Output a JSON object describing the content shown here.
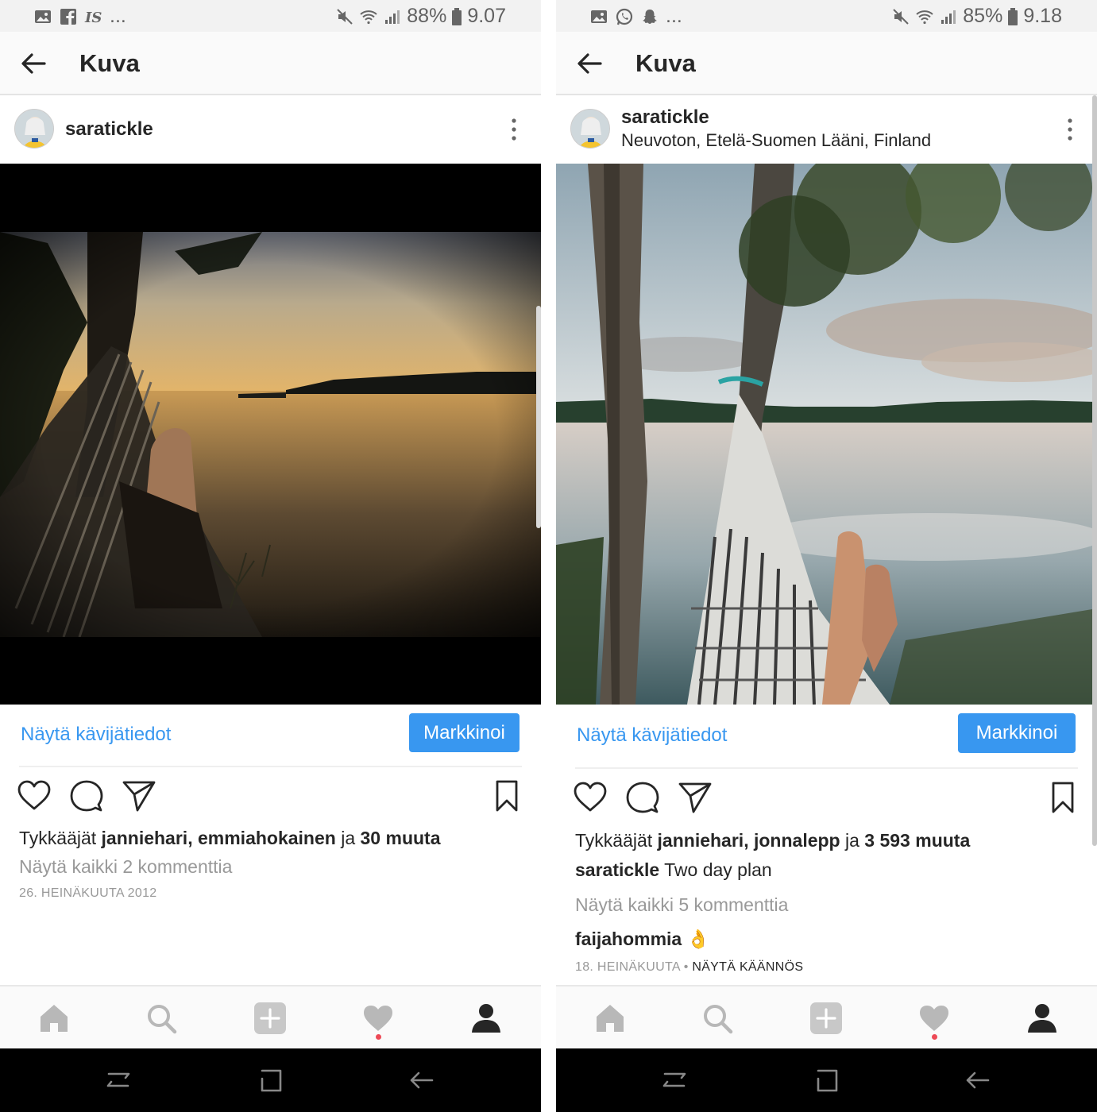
{
  "screens": [
    {
      "status": {
        "battery": "88%",
        "time": "9.07",
        "left_icons": [
          "image-icon",
          "facebook-icon",
          "is-icon"
        ],
        "more": "..."
      },
      "appbar": {
        "title": "Kuva"
      },
      "post": {
        "username": "saratickle",
        "location": "",
        "insights": "Näytä kävijätiedot",
        "promote": "Markkinoi",
        "likes_prefix": "Tykkääjät",
        "liker1": "janniehari,",
        "liker2": "emmiahokainen",
        "likes_and": "ja",
        "likes_more": "30 muuta",
        "view_comments": "Näytä kaikki 2 kommenttia",
        "date": "26. HEINÄKUUTA 2012"
      }
    },
    {
      "status": {
        "battery": "85%",
        "time": "9.18",
        "left_icons": [
          "image-icon",
          "whatsapp-icon",
          "snapchat-icon"
        ],
        "more": "..."
      },
      "appbar": {
        "title": "Kuva"
      },
      "post": {
        "username": "saratickle",
        "location": "Neuvoton, Etelä-Suomen Lääni, Finland",
        "insights": "Näytä kävijätiedot",
        "promote": "Markkinoi",
        "likes_prefix": "Tykkääjät",
        "liker1": "janniehari,",
        "liker2": "jonnalepp",
        "likes_and": "ja",
        "likes_more": "3 593 muuta",
        "caption_user": "saratickle",
        "caption": "Two day plan",
        "view_comments": "Näytä kaikki 5 kommenttia",
        "comment_user": "faijahommia",
        "comment_emoji": "👌",
        "date": "18. HEINÄKUUTA",
        "date_sep": "•",
        "translate": "NÄYTÄ KÄÄNNÖS"
      }
    }
  ],
  "colors": {
    "accent": "#3897f0",
    "text": "#262626",
    "muted": "#999999",
    "notification": "#ed4956"
  }
}
